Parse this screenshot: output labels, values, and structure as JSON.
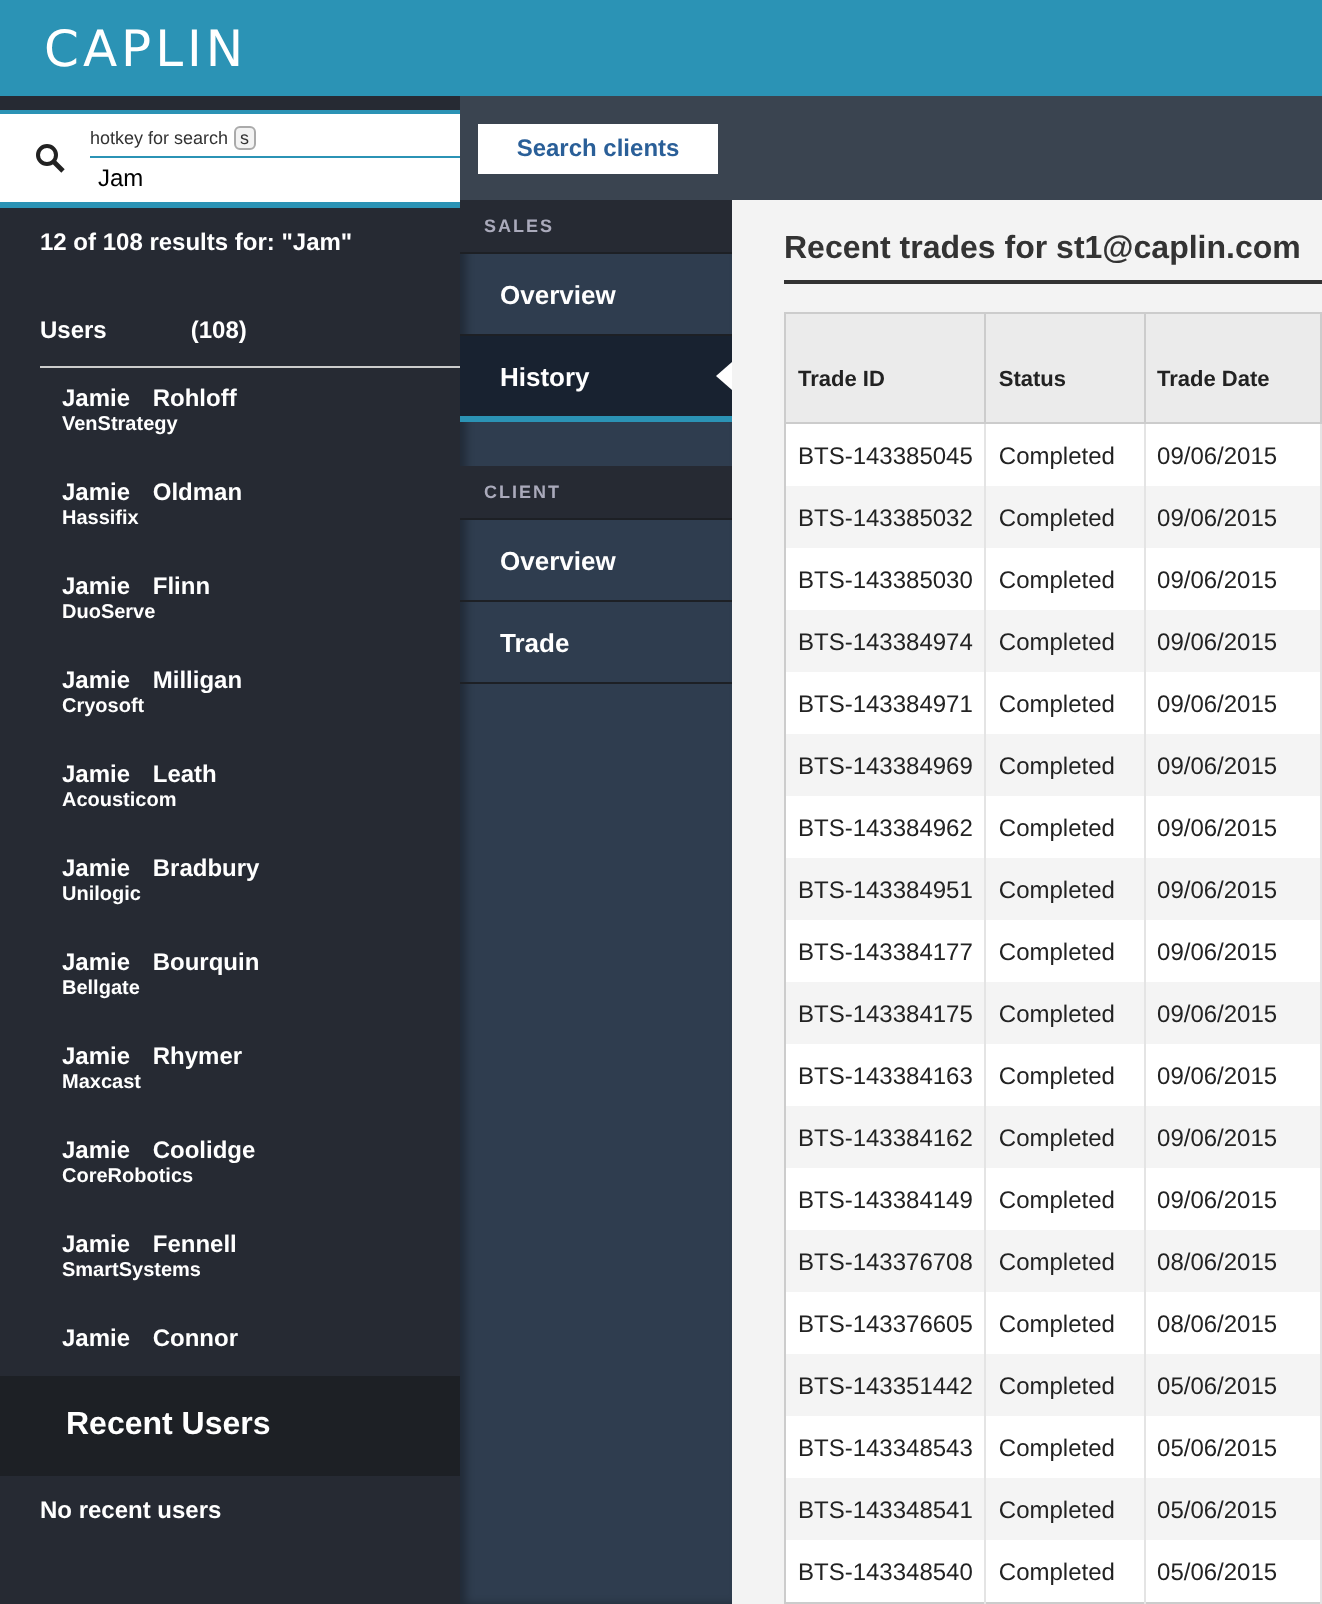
{
  "header": {
    "logo": "CAPLIN"
  },
  "search": {
    "hint": "hotkey for search",
    "hotkey": "s",
    "value": "Jam"
  },
  "results_summary": "12 of 108 results for: \"Jam\"",
  "users": {
    "title": "Users",
    "count": "(108)",
    "items": [
      {
        "name": "Jamie Rohloff",
        "company": "VenStrategy"
      },
      {
        "name": "Jamie Oldman",
        "company": "Hassifix"
      },
      {
        "name": "Jamie Flinn",
        "company": "DuoServe"
      },
      {
        "name": "Jamie Milligan",
        "company": "Cryosoft"
      },
      {
        "name": "Jamie Leath",
        "company": "Acousticom"
      },
      {
        "name": "Jamie Bradbury",
        "company": "Unilogic"
      },
      {
        "name": "Jamie Bourquin",
        "company": "Bellgate"
      },
      {
        "name": "Jamie Rhymer",
        "company": "Maxcast"
      },
      {
        "name": "Jamie Coolidge",
        "company": "CoreRobotics"
      },
      {
        "name": "Jamie Fennell",
        "company": "SmartSystems"
      },
      {
        "name": "Jamie Connor"
      }
    ]
  },
  "recent_users": {
    "title": "Recent Users",
    "empty_text": "No recent users"
  },
  "search_clients_button": "Search clients",
  "nav": [
    {
      "section": "SALES",
      "items": [
        {
          "label": "Overview",
          "selected": false
        },
        {
          "label": "History",
          "selected": true
        }
      ]
    },
    {
      "section": "CLIENT",
      "items": [
        {
          "label": "Overview",
          "selected": false
        },
        {
          "label": "Trade",
          "selected": false
        }
      ]
    }
  ],
  "content": {
    "title": "Recent trades for st1@caplin.com",
    "table": {
      "columns": [
        "Trade ID",
        "Status",
        "Trade Date"
      ],
      "rows": [
        [
          "BTS-143385045",
          "Completed",
          "09/06/2015"
        ],
        [
          "BTS-143385032",
          "Completed",
          "09/06/2015"
        ],
        [
          "BTS-143385030",
          "Completed",
          "09/06/2015"
        ],
        [
          "BTS-143384974",
          "Completed",
          "09/06/2015"
        ],
        [
          "BTS-143384971",
          "Completed",
          "09/06/2015"
        ],
        [
          "BTS-143384969",
          "Completed",
          "09/06/2015"
        ],
        [
          "BTS-143384962",
          "Completed",
          "09/06/2015"
        ],
        [
          "BTS-143384951",
          "Completed",
          "09/06/2015"
        ],
        [
          "BTS-143384177",
          "Completed",
          "09/06/2015"
        ],
        [
          "BTS-143384175",
          "Completed",
          "09/06/2015"
        ],
        [
          "BTS-143384163",
          "Completed",
          "09/06/2015"
        ],
        [
          "BTS-143384162",
          "Completed",
          "09/06/2015"
        ],
        [
          "BTS-143384149",
          "Completed",
          "09/06/2015"
        ],
        [
          "BTS-143376708",
          "Completed",
          "08/06/2015"
        ],
        [
          "BTS-143376605",
          "Completed",
          "08/06/2015"
        ],
        [
          "BTS-143351442",
          "Completed",
          "05/06/2015"
        ],
        [
          "BTS-143348543",
          "Completed",
          "05/06/2015"
        ],
        [
          "BTS-143348541",
          "Completed",
          "05/06/2015"
        ],
        [
          "BTS-143348540",
          "Completed",
          "05/06/2015"
        ]
      ]
    }
  }
}
